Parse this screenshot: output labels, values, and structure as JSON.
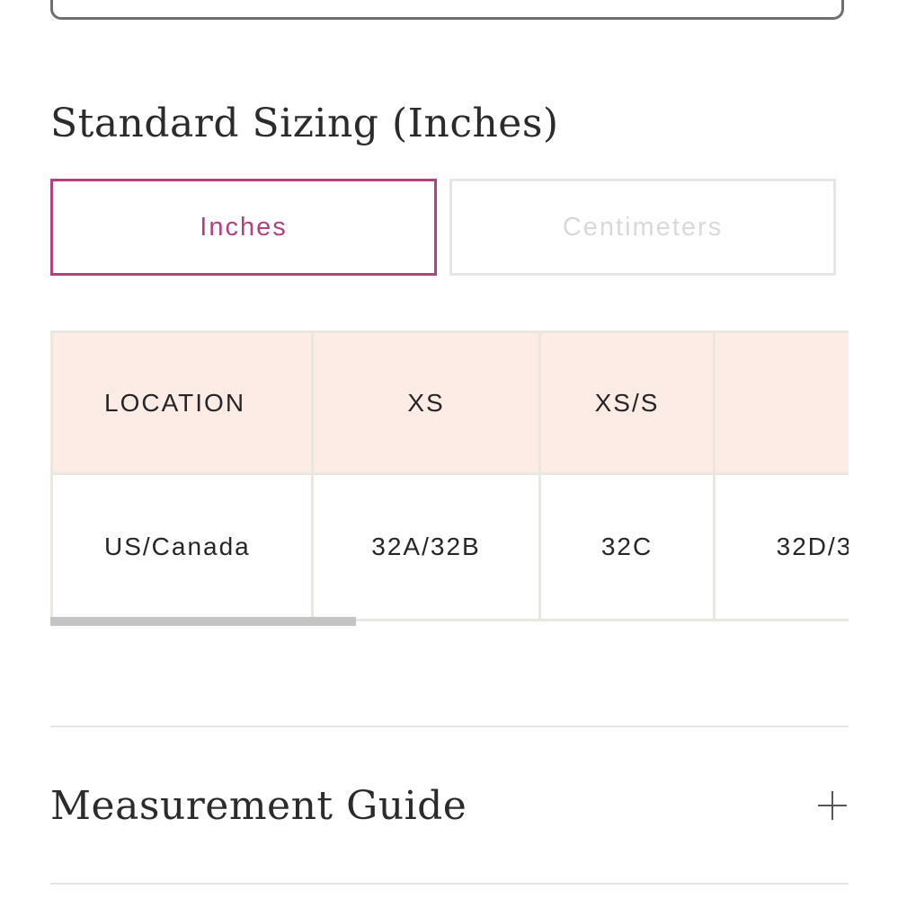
{
  "section": {
    "title": "Standard Sizing (Inches)"
  },
  "unit_toggle": {
    "inches_label": "Inches",
    "centimeters_label": "Centimeters",
    "selected": "Inches",
    "active_color": "#b3407f"
  },
  "size_table": {
    "headers": [
      "LOCATION",
      "XS",
      "XS/S",
      ""
    ],
    "rows": [
      [
        "US/Canada",
        "32A/32B",
        "32C",
        "32D/3"
      ]
    ],
    "header_background": "#fdebe6"
  },
  "accordion": {
    "title": "Measurement Guide",
    "icon": "plus-icon"
  }
}
